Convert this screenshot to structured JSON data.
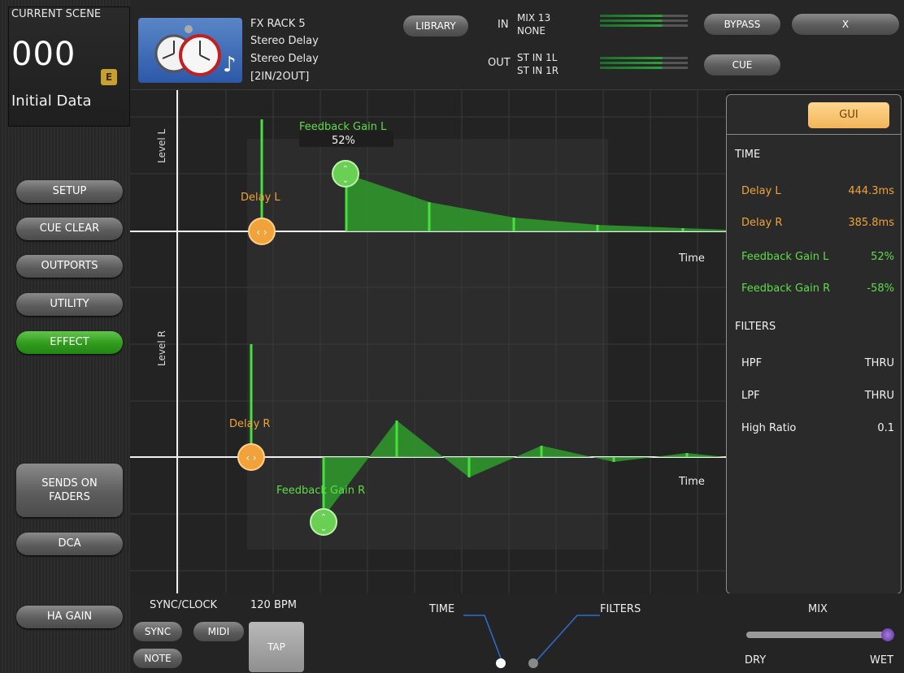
{
  "scene": {
    "label": "CURRENT SCENE",
    "number": "000",
    "badge": "E",
    "name": "Initial Data"
  },
  "sidebar": {
    "items": [
      {
        "label": "SETUP"
      },
      {
        "label": "CUE CLEAR"
      },
      {
        "label": "OUTPORTS"
      },
      {
        "label": "UTILITY"
      },
      {
        "label": "EFFECT"
      },
      {
        "label": "SENDS ON FADERS"
      },
      {
        "label": "DCA"
      },
      {
        "label": "HA GAIN"
      }
    ]
  },
  "header": {
    "fx_rack": "FX RACK 5",
    "effect_type": "Stereo Delay",
    "effect_name": "Stereo Delay",
    "io_config": "[2IN/2OUT]",
    "library_label": "LIBRARY",
    "in_label": "IN",
    "in_source_1": "MIX 13",
    "in_source_2": "NONE",
    "out_label": "OUT",
    "out_dest_1": "ST IN 1L",
    "out_dest_2": "ST IN 1R",
    "bypass_label": "BYPASS",
    "close_label": "X",
    "cue_label": "CUE",
    "icon": "clock-icon"
  },
  "graph": {
    "level_l_label": "Level L",
    "level_r_label": "Level R",
    "time_label_top": "Time",
    "time_label_bottom": "Time",
    "delay_l_label": "Delay L",
    "delay_r_label": "Delay R",
    "feedback_l_label": "Feedback Gain L",
    "feedback_l_value": "52%",
    "feedback_r_label": "Feedback Gain R"
  },
  "panel": {
    "gui_label": "GUI",
    "time_heading": "TIME",
    "delay_l": {
      "label": "Delay L",
      "value": "444.3ms"
    },
    "delay_r": {
      "label": "Delay R",
      "value": "385.8ms"
    },
    "feedback_l": {
      "label": "Feedback Gain L",
      "value": "52%"
    },
    "feedback_r": {
      "label": "Feedback Gain R",
      "value": "-58%"
    },
    "filters_heading": "FILTERS",
    "hpf": {
      "label": "HPF",
      "value": "THRU"
    },
    "lpf": {
      "label": "LPF",
      "value": "THRU"
    },
    "high_ratio": {
      "label": "High Ratio",
      "value": "0.1"
    }
  },
  "bottom": {
    "sync_clock_label": "SYNC/CLOCK",
    "bpm": "120 BPM",
    "sync_label": "SYNC",
    "midi_label": "MIDI",
    "note_label": "NOTE",
    "tap_label": "TAP",
    "time_tab": "TIME",
    "filters_tab": "FILTERS",
    "mix_label": "MIX",
    "dry_label": "DRY",
    "wet_label": "WET",
    "mix_level": 1.0
  },
  "colors": {
    "accent_orange": "#f0a33a",
    "accent_green": "#5fdc4a",
    "effect_button": "#2f9a1c"
  }
}
